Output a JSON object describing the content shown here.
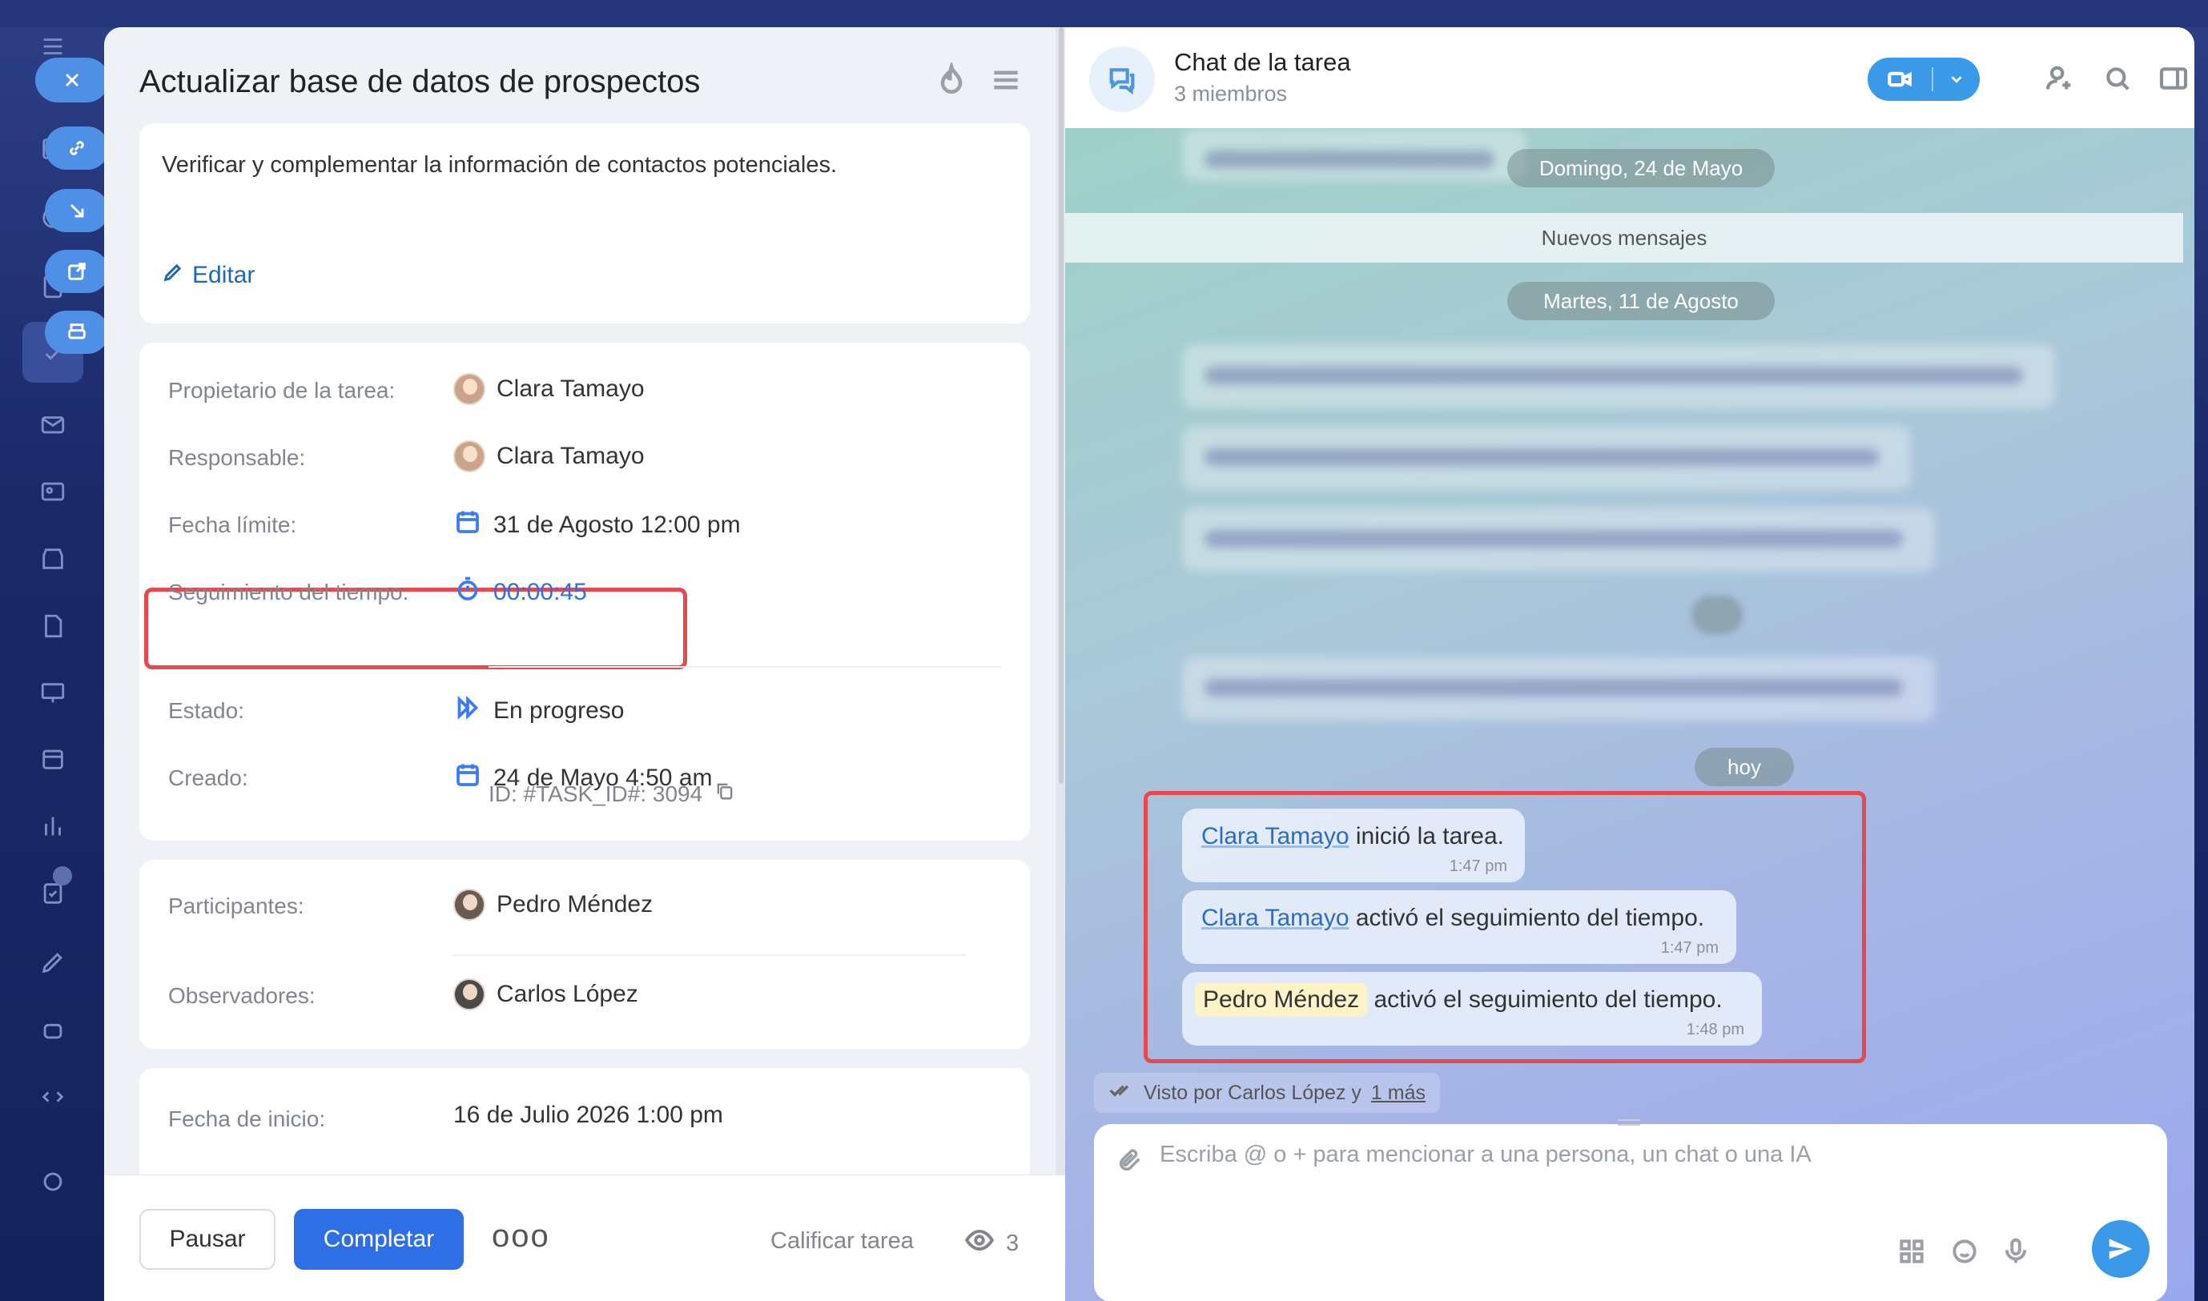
{
  "task": {
    "title": "Actualizar base de datos de prospectos",
    "description": "Verificar y complementar la información de contactos potenciales.",
    "edit_label": "Editar",
    "fields": {
      "owner_label": "Propietario de la tarea:",
      "owner_value": "Clara Tamayo",
      "responsible_label": "Responsable:",
      "responsible_value": "Clara Tamayo",
      "deadline_label": "Fecha límite:",
      "deadline_value": "31 de Agosto 12:00 pm",
      "time_tracking_label": "Seguimiento del tiempo:",
      "time_tracking_value": "00:00:45",
      "status_label": "Estado:",
      "status_value": "En progreso",
      "created_label": "Creado:",
      "created_value": "24 de Mayo 4:50 am",
      "id_value": "ID: #TASK_ID#: 3094",
      "participants_label": "Participantes:",
      "participants_value": "Pedro Méndez",
      "observers_label": "Observadores:",
      "observers_value": "Carlos López",
      "start_date_label": "Fecha de inicio:",
      "start_date_value": "16 de Julio 2026 1:00 pm"
    },
    "footer": {
      "pause_label": "Pausar",
      "complete_label": "Completar",
      "more_label": "ooo",
      "rate_label": "Calificar tarea",
      "views_count": "3"
    }
  },
  "chat": {
    "title": "Chat de la tarea",
    "members": "3 miembros",
    "date_sunday": "Domingo, 24 de Mayo",
    "new_messages": "Nuevos mensajes",
    "date_tuesday": "Martes, 11 de Agosto",
    "date_today": "hoy",
    "messages": [
      {
        "author": "Clara Tamayo",
        "text": "inició la tarea.",
        "time": "1:47 pm"
      },
      {
        "author": "Clara Tamayo",
        "text": "activó el seguimiento del tiempo.",
        "time": "1:47 pm"
      },
      {
        "author": "Pedro Méndez",
        "text": "activó el seguimiento del tiempo.",
        "time": "1:48 pm"
      }
    ],
    "seen_prefix": "Visto por Carlos López y",
    "seen_more": "1 más",
    "composer_placeholder": "Escriba @ o + para mencionar a una persona, un chat o una IA"
  },
  "colors": {
    "accent": "#2f6fe6",
    "highlight": "#e5484d",
    "link": "#2b6cc4"
  }
}
